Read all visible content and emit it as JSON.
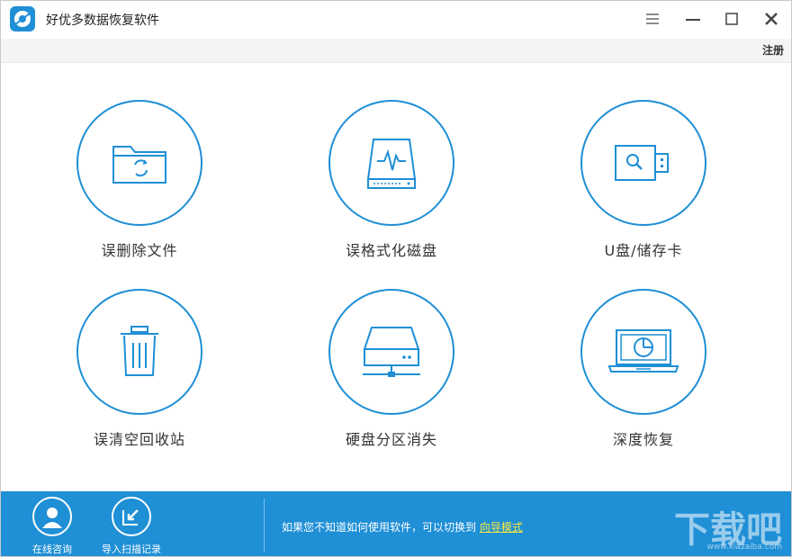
{
  "titlebar": {
    "title": "好优多数据恢复软件"
  },
  "subbar": {
    "register": "注册"
  },
  "tiles": [
    {
      "label": "误删除文件",
      "icon": "folder-recycle-icon"
    },
    {
      "label": "误格式化磁盘",
      "icon": "disk-activity-icon"
    },
    {
      "label": "U盘/储存卡",
      "icon": "usb-search-icon"
    },
    {
      "label": "误清空回收站",
      "icon": "trash-bin-icon"
    },
    {
      "label": "硬盘分区消失",
      "icon": "hard-drive-network-icon"
    },
    {
      "label": "深度恢复",
      "icon": "laptop-scan-icon"
    }
  ],
  "footer": {
    "consult": "在线咨询",
    "import": "导入扫描记录",
    "hint_prefix": "如果您不知道如何使用软件，可以切换到",
    "hint_link": "向导模式"
  },
  "watermark": {
    "main": "下载吧",
    "sub": "www.xiazaiba.com"
  },
  "colors": {
    "accent": "#1f8fd6",
    "link": "#ffea3b"
  }
}
